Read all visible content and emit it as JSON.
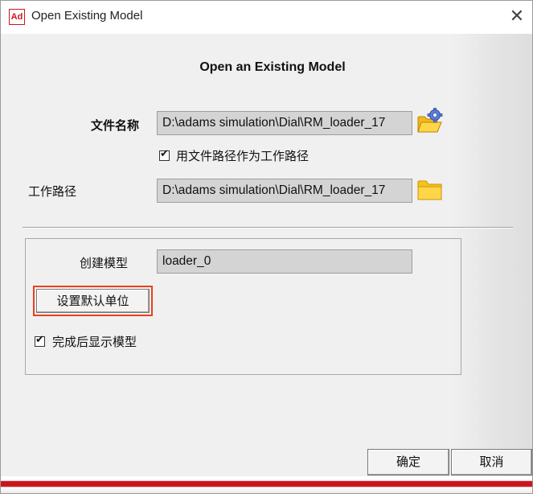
{
  "window": {
    "app_icon_text": "Ad",
    "title": "Open Existing Model",
    "close_glyph": "✕"
  },
  "dialog": {
    "heading": "Open an Existing Model",
    "file_name": {
      "label": "文件名称",
      "value": "D:\\adams simulation\\Dial\\RM_loader_17",
      "browse_icon": "folder-gear-icon"
    },
    "use_file_path_checkbox": {
      "label": "用文件路径作为工作路径",
      "checked": true
    },
    "working_dir": {
      "label": "工作路径",
      "value": "D:\\adams simulation\\Dial\\RM_loader_17",
      "browse_icon": "folder-icon"
    },
    "group": {
      "create_model_label": "创建模型",
      "create_model_value": "loader_0",
      "set_units_button": "设置默认单位",
      "show_model_checkbox": {
        "label": "完成后显示模型",
        "checked": true
      }
    },
    "ok_button": "确定",
    "cancel_button": "取消"
  },
  "colors": {
    "accent_red": "#c8161d",
    "highlight": "#e8411f",
    "folder_yellow": "#f5c518",
    "field_bg": "#d4d4d4"
  }
}
